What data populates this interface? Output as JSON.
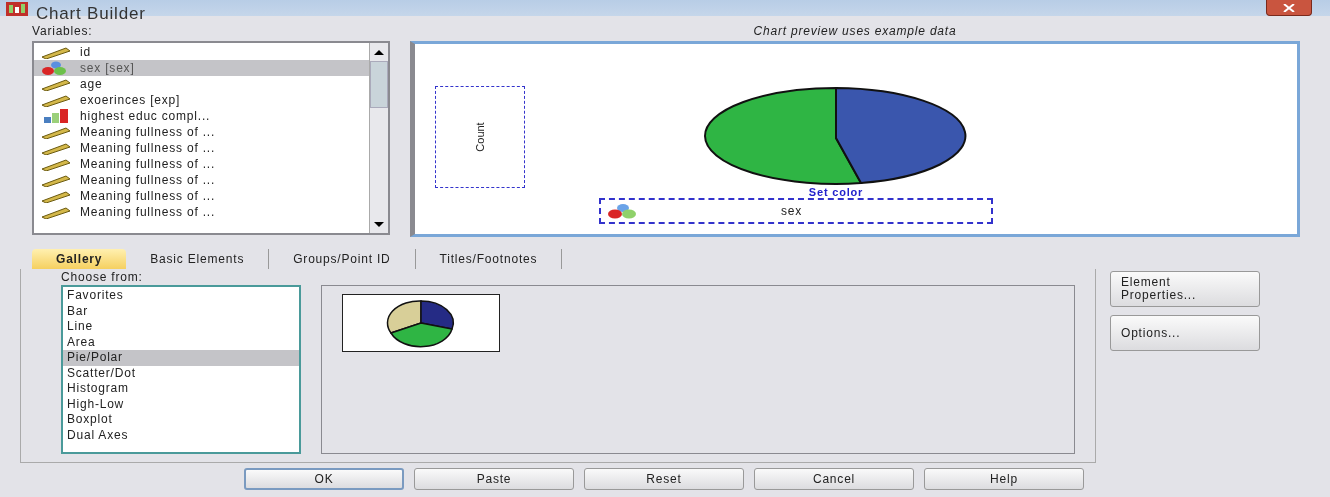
{
  "window": {
    "title": "Chart Builder"
  },
  "variables": {
    "label": "Variables:",
    "items": [
      {
        "name": "id",
        "kind": "scale",
        "selected": false
      },
      {
        "name": "sex [sex]",
        "kind": "nominal",
        "selected": true
      },
      {
        "name": "age",
        "kind": "scale",
        "selected": false
      },
      {
        "name": "exoerinces [exp]",
        "kind": "scale",
        "selected": false
      },
      {
        "name": "highest educ compl...",
        "kind": "ordinal",
        "selected": false
      },
      {
        "name": "Meaning fullness of ...",
        "kind": "scale",
        "selected": false
      },
      {
        "name": "Meaning fullness of ...",
        "kind": "scale",
        "selected": false
      },
      {
        "name": "Meaning fullness of ...",
        "kind": "scale",
        "selected": false
      },
      {
        "name": "Meaning fullness of ...",
        "kind": "scale",
        "selected": false
      },
      {
        "name": "Meaning fullness of ...",
        "kind": "scale",
        "selected": false
      },
      {
        "name": "Meaning fullness of ...",
        "kind": "scale",
        "selected": false
      }
    ]
  },
  "preview": {
    "caption": "Chart preview uses example data",
    "y_axis_label": "Count",
    "set_color_link": "Set color",
    "color_drop_zone": "sex"
  },
  "tabs": [
    {
      "label": "Gallery",
      "selected": true
    },
    {
      "label": "Basic Elements",
      "selected": false
    },
    {
      "label": "Groups/Point ID",
      "selected": false
    },
    {
      "label": "Titles/Footnotes",
      "selected": false
    }
  ],
  "gallery": {
    "label": "Choose from:",
    "items": [
      {
        "label": "Favorites",
        "selected": false
      },
      {
        "label": "Bar",
        "selected": false
      },
      {
        "label": "Line",
        "selected": false
      },
      {
        "label": "Area",
        "selected": false
      },
      {
        "label": "Pie/Polar",
        "selected": true
      },
      {
        "label": "Scatter/Dot",
        "selected": false
      },
      {
        "label": "Histogram",
        "selected": false
      },
      {
        "label": "High-Low",
        "selected": false
      },
      {
        "label": "Boxplot",
        "selected": false
      },
      {
        "label": "Dual Axes",
        "selected": false
      }
    ]
  },
  "side_buttons": [
    "Element Properties...",
    "Options..."
  ],
  "buttons": [
    {
      "label": "OK",
      "default": true
    },
    {
      "label": "Paste",
      "default": false
    },
    {
      "label": "Reset",
      "default": false
    },
    {
      "label": "Cancel",
      "default": false
    },
    {
      "label": "Help",
      "default": false
    }
  ]
}
